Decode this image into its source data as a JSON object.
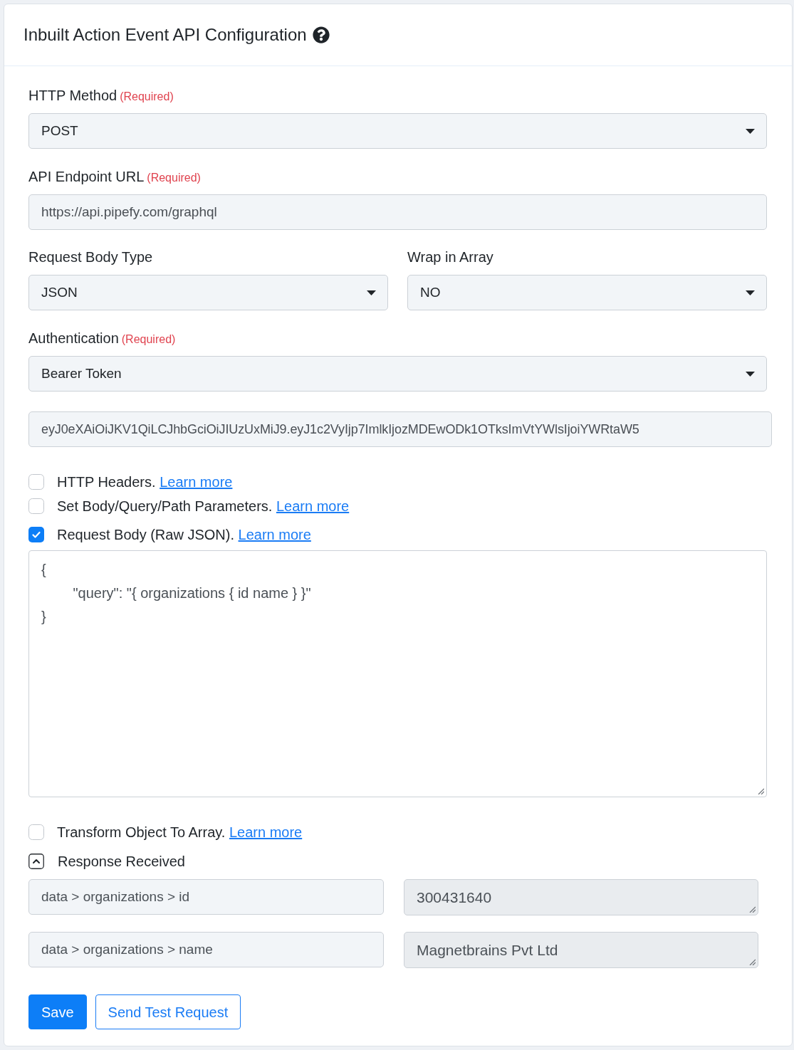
{
  "card_header": {
    "title": "Inbuilt Action Event API Configuration"
  },
  "http_method": {
    "label": "HTTP Method",
    "required_note": "(Required)",
    "value": "POST"
  },
  "api_endpoint_url": {
    "label": "API Endpoint URL",
    "required_note": "(Required)",
    "value": "https://api.pipefy.com/graphql"
  },
  "request_body_type": {
    "label": "Request Body Type",
    "value": "JSON"
  },
  "wrap_in_array": {
    "label": "Wrap in Array",
    "value": "NO"
  },
  "authentication": {
    "label": "Authentication",
    "required_note": "(Required)",
    "value": "Bearer Token",
    "token": "eyJ0eXAiOiJKV1QiLCJhbGciOiJIUzUxMiJ9.eyJ1c2VyIjp7ImlkIjozMDEwODk1OTksImVtYWlsIjoiYWRtaW5"
  },
  "options": [
    {
      "label": "HTTP Headers.",
      "link": "Learn more",
      "checked": false
    },
    {
      "label": "Set Body/Query/Path Parameters.",
      "link": "Learn more",
      "checked": false
    },
    {
      "label": "Request Body (Raw JSON).",
      "link": "Learn more",
      "checked": true,
      "body": "{\n\t\"query\": \"{ organizations { id name } }\"\n}"
    },
    {
      "label": "Transform Object To Array.",
      "link": "Learn more",
      "checked": false
    }
  ],
  "response": {
    "title": "Response Received",
    "expanded": true,
    "rows": [
      {
        "path": "data > organizations > id",
        "value": "300431640"
      },
      {
        "path": "data > organizations > name",
        "value": "Magnetbrains Pvt Ltd"
      }
    ]
  },
  "buttons": [
    {
      "label": "Save",
      "kind": "primary"
    },
    {
      "label": "Send Test Request",
      "kind": "outline"
    }
  ]
}
